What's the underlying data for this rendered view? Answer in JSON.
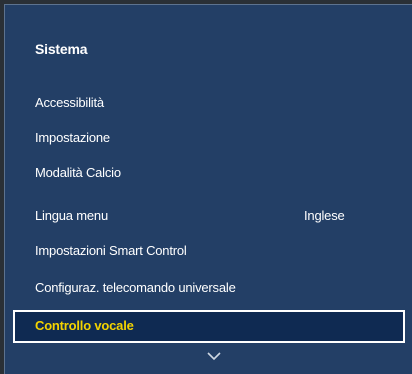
{
  "menu": {
    "title": "Sistema",
    "items": [
      {
        "label": "Accessibilità"
      },
      {
        "label": "Impostazione"
      },
      {
        "label": "Modalità Calcio"
      },
      {
        "label": "Lingua menu",
        "value": "Inglese"
      },
      {
        "label": "Impostazioni Smart Control"
      },
      {
        "label": "Configuraz. telecomando universale"
      },
      {
        "label": "Controllo vocale"
      }
    ],
    "selected_index": 6
  },
  "colors": {
    "panel_bg": "#233f66",
    "selected_bg": "#0f2a52",
    "selected_text": "#f3d300",
    "text": "#ffffff"
  },
  "icons": {
    "scroll_down": "chevron-down-icon"
  }
}
